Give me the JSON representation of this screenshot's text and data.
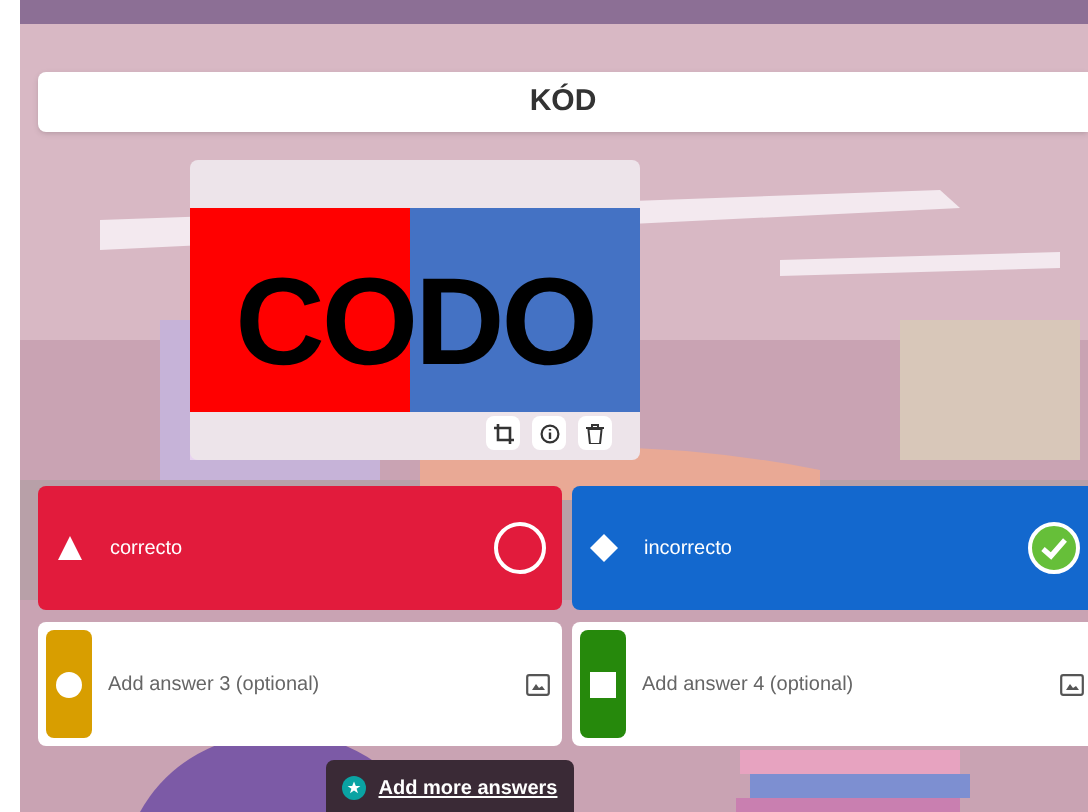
{
  "question": {
    "title": "KÓD"
  },
  "media": {
    "image_text": "CODO"
  },
  "answers": [
    {
      "kind": "triangle",
      "color": "#e21b3c",
      "text": "correcto",
      "correct": false
    },
    {
      "kind": "diamond",
      "color": "#1368ce",
      "text": "incorrecto",
      "correct": true
    },
    {
      "kind": "circle",
      "color": "#d89e00",
      "placeholder": "Add answer 3 (optional)"
    },
    {
      "kind": "square",
      "color": "#26890c",
      "placeholder": "Add answer 4 (optional)"
    }
  ],
  "add_more": {
    "label": "Add more answers"
  }
}
